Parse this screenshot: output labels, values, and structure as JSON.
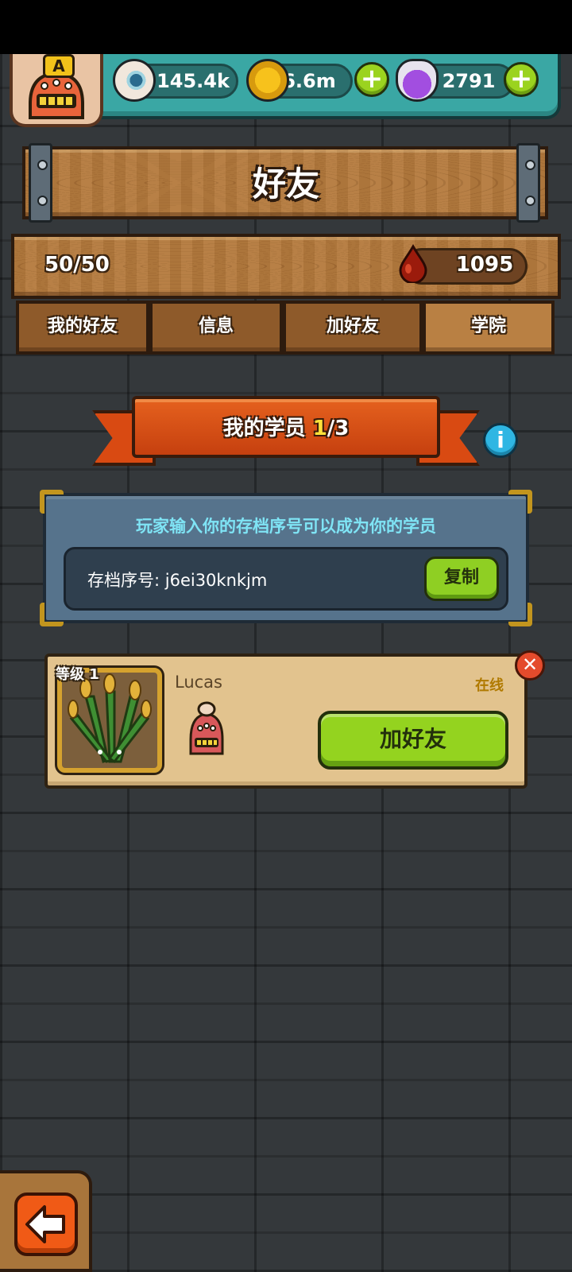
{
  "resources": {
    "eyes": "145.4k",
    "coins": "6.6m",
    "potions": "2791"
  },
  "avatar": {
    "rank": "A"
  },
  "header": {
    "title": "好友"
  },
  "friends_info": {
    "capacity": "50/50",
    "blood_drops": "1095"
  },
  "tabs": [
    {
      "label": "我的好友",
      "active": false
    },
    {
      "label": "信息",
      "active": false
    },
    {
      "label": "加好友",
      "active": false
    },
    {
      "label": "学院",
      "active": true
    }
  ],
  "academy": {
    "banner_label": "我的学员",
    "students_current": "1",
    "students_suffix": "/3",
    "hint": "玩家输入你的存档序号可以成为你的学员",
    "save_code_label": "存档序号: j6ei30knkjm",
    "copy_label": "复制"
  },
  "student": {
    "level_label": "等级 1",
    "name": "Lucas",
    "status": "在线",
    "add_friend_label": "加好友"
  },
  "colors": {
    "wood": "#b57b3e",
    "teal_bar": "#3aa7a4",
    "green_button": "#94d31f",
    "banner_red": "#d94a12",
    "stone_panel": "#56738c"
  }
}
